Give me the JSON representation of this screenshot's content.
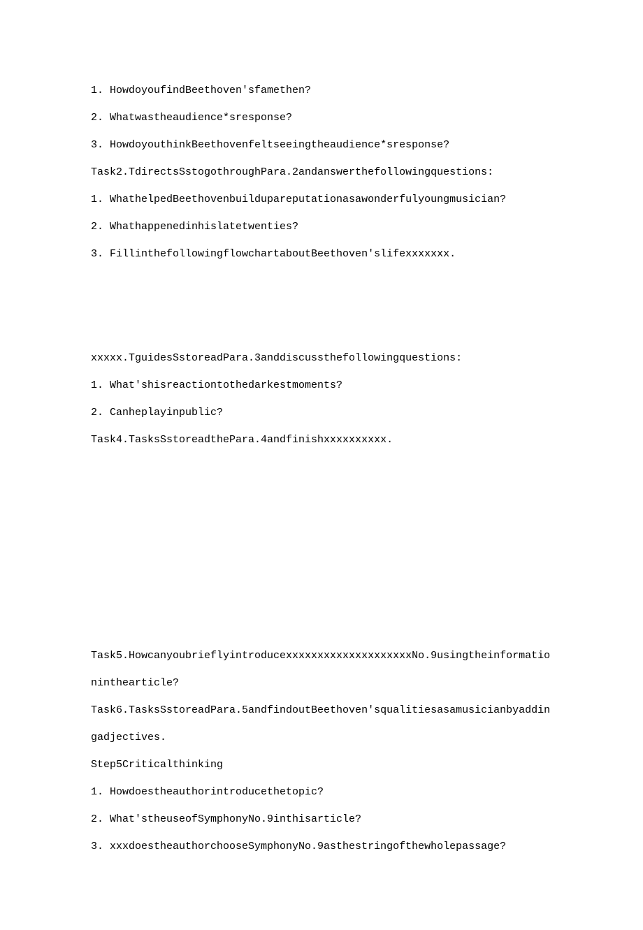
{
  "lines": [
    "1. HowdoyoufindBeethoven'sfamethen?",
    "2. Whatwastheaudience*sresponse?",
    "3. HowdoyouthinkBeethovenfeltseeingtheaudience*sresponse?",
    "Task2.TdirectsSstogothroughPara.2andanswerthefollowingquestions:",
    "1. WhathelpedBeethovenbuildupareputationasawonderfulyoungmusician?",
    "2. Whathappenedinhislatetwenties?",
    "3. FillinthefollowingflowchartaboutBeethoven'slifexxxxxxx."
  ],
  "lines2": [
    "xxxxx.TguidesSstoreadPara.3anddiscussthefollowingquestions:",
    "1. What'shisreactiontothedarkestmoments?",
    "2. Canheplayinpublic?",
    "Task4.TasksSstoreadthePara.4andfinishxxxxxxxxxx."
  ],
  "lines3": [
    "Task5.HowcanyoubrieflyintroducexxxxxxxxxxxxxxxxxxxxNo.9usingtheinformationinthearticle?",
    "Task6.TasksSstoreadPara.5andfindoutBeethoven'squalitiesasamusicianbyaddingadjectives.",
    "Step5Criticalthinking",
    "1. Howdoestheauthorintroducethetopic?",
    "2. What'stheuseofSymphonyNo.9inthisarticle?",
    "3. xxxdoestheauthorchooseSymphonyNo.9asthestringofthewholepassage?"
  ]
}
